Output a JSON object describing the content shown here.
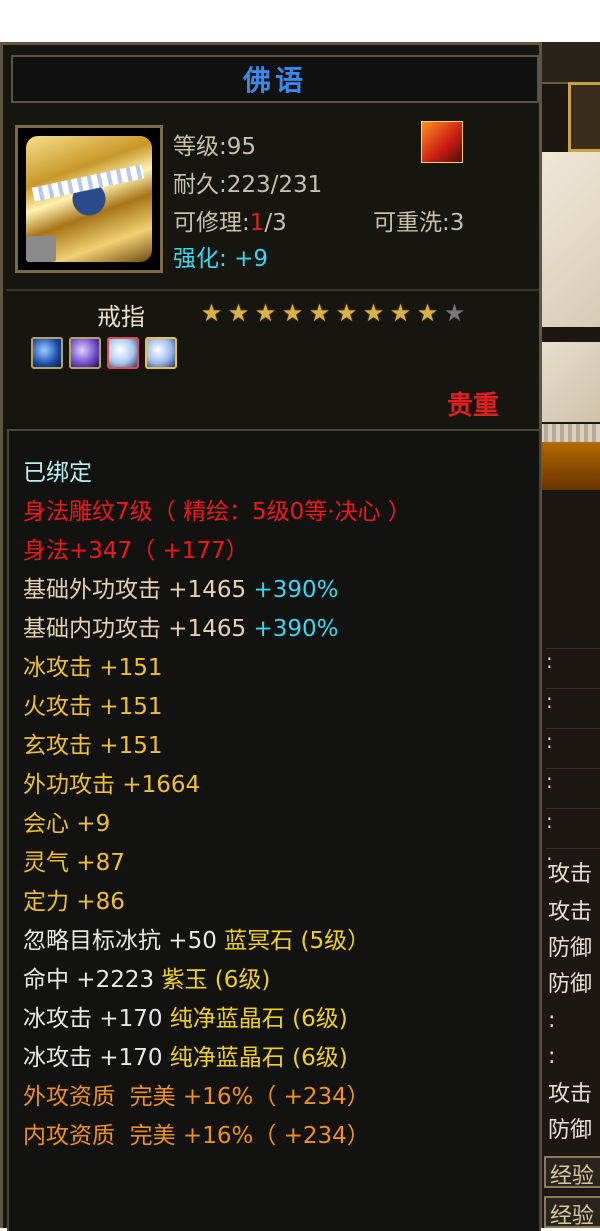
{
  "item": {
    "name": "佛语",
    "level_label": "等级:95",
    "durability_prefix": "耐久:",
    "durability_value": "223/231",
    "repair_prefix": "可修理:",
    "repair_used": "1",
    "repair_total": "/3",
    "rewash": "可重洗:3",
    "enhance_label": "强化:",
    "enhance_value": "+9",
    "type": "戒指",
    "stars_filled": 9,
    "stars_total": 10,
    "rarity": "贵重"
  },
  "attributes": {
    "bound": "已绑定",
    "engrave": "身法雕纹7级（ 精绘：5级0等·决心 ）",
    "agility": "身法+347（ +177）",
    "outer_base_label": "基础外功攻击 +1465",
    "outer_base_pct": "+390%",
    "inner_base_label": "基础内功攻击 +1465",
    "inner_base_pct": "+390%",
    "ice_attack": "冰攻击 +151",
    "fire_attack": "火攻击 +151",
    "mystic_attack": "玄攻击 +151",
    "outer_attack": "外功攻击 +1664",
    "crit": "会心 +9",
    "spirit": "灵气 +87",
    "focus": "定力 +86",
    "gem1_stat": "忽略目标冰抗 +50",
    "gem1_name": "蓝冥石 (5级）",
    "gem2_stat": "命中 +2223",
    "gem2_name": "紫玉 (6级)",
    "gem3_stat": "冰攻击 +170",
    "gem3_name": "纯净蓝晶石 (6级)",
    "gem4_stat": "冰攻击 +170",
    "gem4_name": "纯净蓝晶石 (6级)",
    "quality_outer": "外攻资质  完美 +16%（ +234）",
    "quality_inner": "内攻资质  完美 +16%（ +234）"
  },
  "background": {
    "rows": [
      ":",
      ":",
      ":",
      ":",
      ":",
      ":"
    ],
    "labels": [
      "攻击",
      "攻击",
      "防御",
      "防御"
    ],
    "colons": [
      ":",
      ":"
    ],
    "labels2": [
      "攻击",
      "防御"
    ],
    "buttons": [
      "经验",
      "经验"
    ]
  }
}
